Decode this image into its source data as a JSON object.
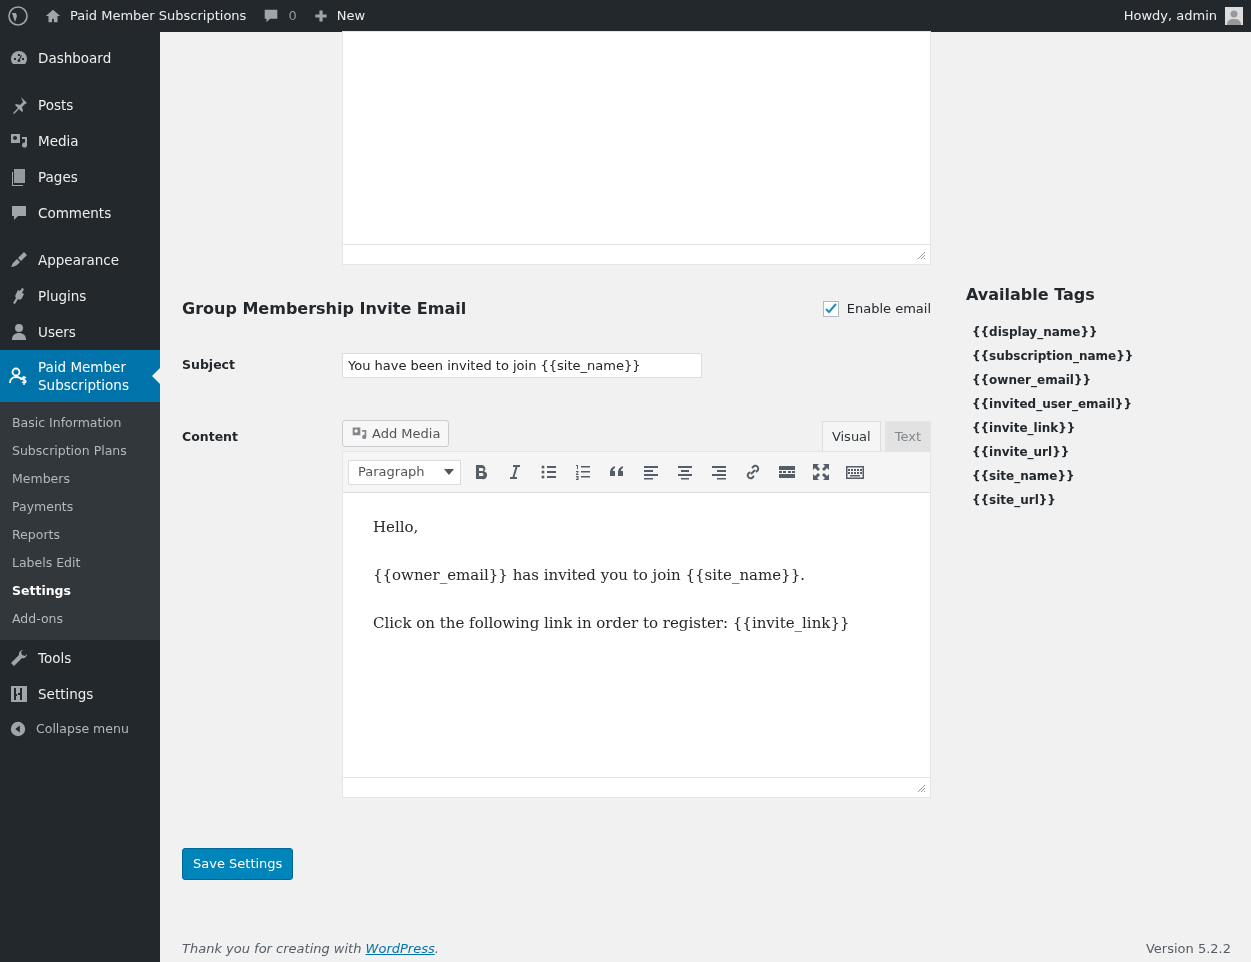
{
  "admin_bar": {
    "site": "Paid Member Subscriptions",
    "comments": "0",
    "new": "New",
    "greeting": "Howdy, admin"
  },
  "sidebar": {
    "groups": [
      [
        {
          "label": "Dashboard",
          "selected": false
        }
      ],
      [
        {
          "label": "Posts",
          "selected": false
        },
        {
          "label": "Media",
          "selected": false
        },
        {
          "label": "Pages",
          "selected": false
        },
        {
          "label": "Comments",
          "selected": false
        }
      ],
      [
        {
          "label": "Appearance",
          "selected": false
        },
        {
          "label": "Plugins",
          "selected": false
        },
        {
          "label": "Users",
          "selected": false
        },
        {
          "label": "Paid Member Subscriptions",
          "selected": true,
          "children": [
            {
              "label": "Basic Information",
              "selected": false
            },
            {
              "label": "Subscription Plans",
              "selected": false
            },
            {
              "label": "Members",
              "selected": false
            },
            {
              "label": "Payments",
              "selected": false
            },
            {
              "label": "Reports",
              "selected": false
            },
            {
              "label": "Labels Edit",
              "selected": false
            },
            {
              "label": "Settings",
              "selected": true
            },
            {
              "label": "Add-ons",
              "selected": false
            }
          ]
        },
        {
          "label": "Tools",
          "selected": false
        },
        {
          "label": "Settings",
          "selected": false
        }
      ]
    ],
    "collapse": "Collapse menu"
  },
  "section": {
    "title": "Group Membership Invite Email",
    "enable": {
      "label": "Enable email",
      "checked": true
    },
    "subject": {
      "label": "Subject",
      "value": "You have been invited to join {{site_name}}"
    },
    "content": {
      "label": "Content",
      "add_media": "Add Media",
      "tabs": [
        {
          "label": "Visual",
          "selected": true
        },
        {
          "label": "Text",
          "selected": false
        }
      ],
      "format": "Paragraph",
      "paragraphs": [
        "Hello,",
        "{{owner_email}} has invited you to join {{site_name}}.",
        "Click on the following link in order to register: {{invite_link}}"
      ]
    }
  },
  "tags": {
    "title": "Available Tags",
    "items": [
      "{{display_name}}",
      "{{subscription_name}}",
      "{{owner_email}}",
      "{{invited_user_email}}",
      "{{invite_link}}",
      "{{invite_url}}",
      "{{site_name}}",
      "{{site_url}}"
    ]
  },
  "save_button": "Save Settings",
  "footer": {
    "thanks": "Thank you for creating with ",
    "link": "WordPress",
    "period": ".",
    "version": "Version 5.2.2"
  }
}
